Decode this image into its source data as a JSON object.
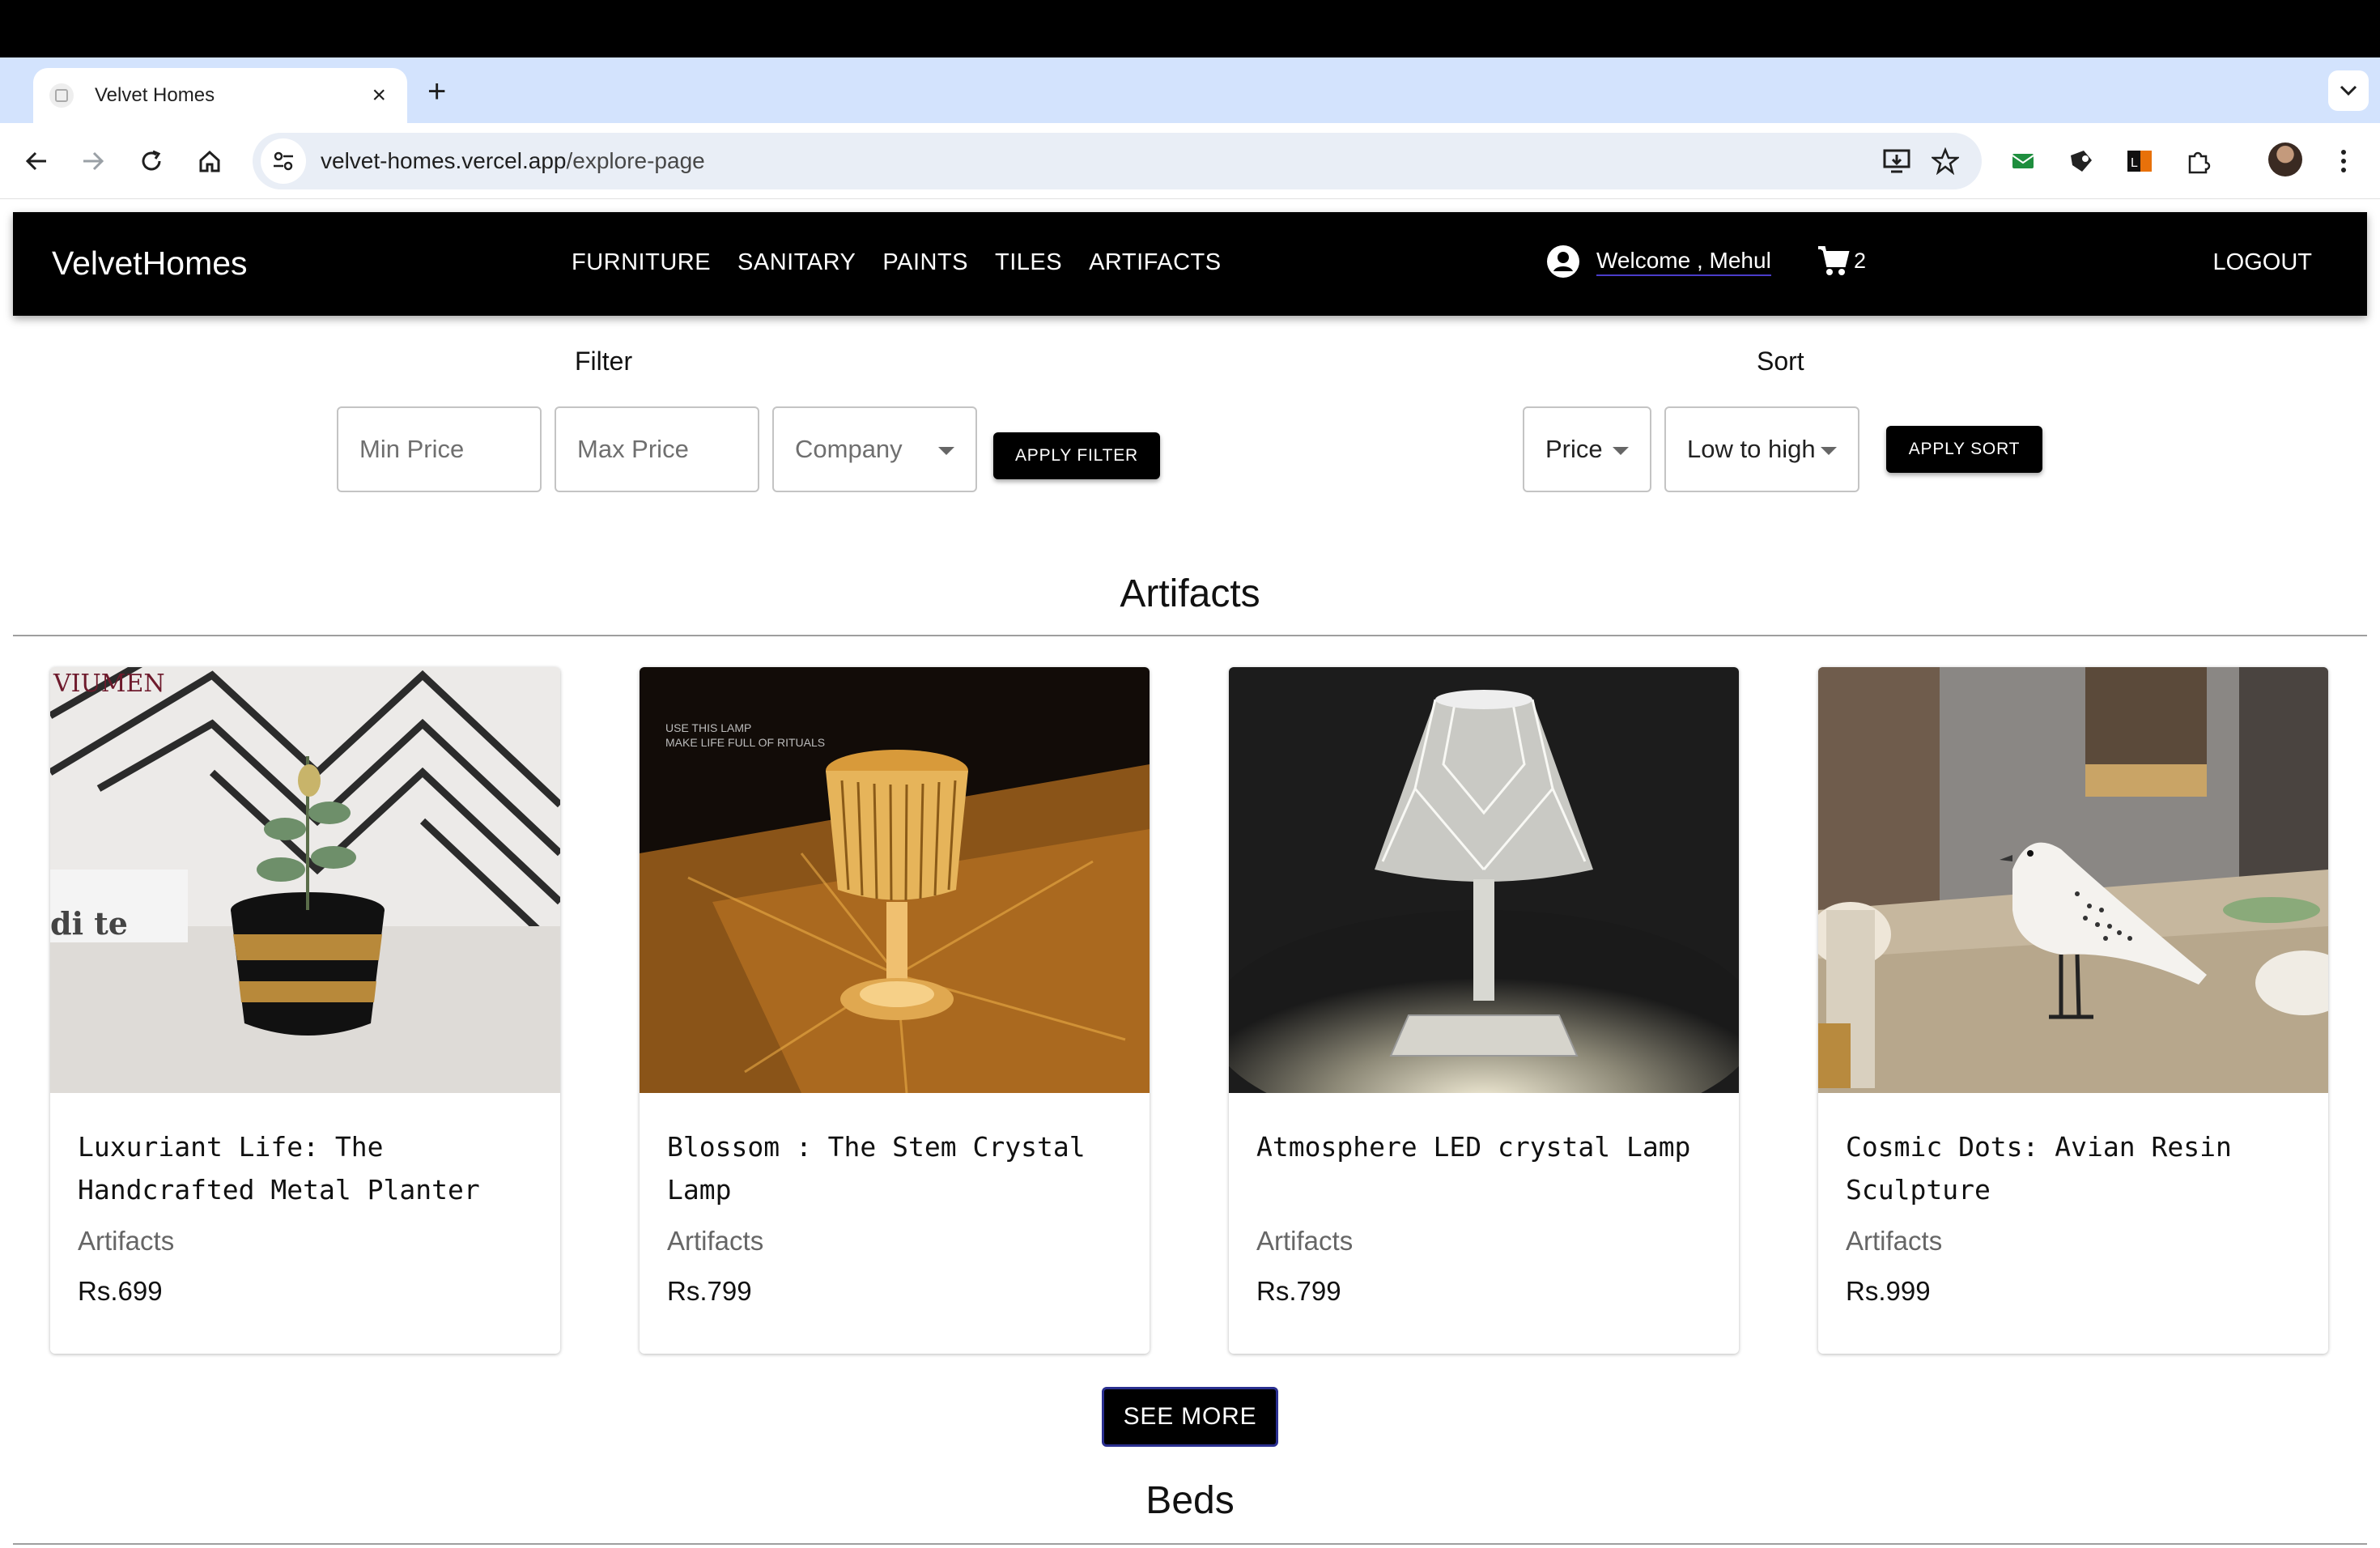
{
  "browser": {
    "tab_title": "Velvet Homes",
    "url_host": "velvet-homes.vercel.app",
    "url_path": "/explore-page"
  },
  "header": {
    "brand": "VelvetHomes",
    "nav": [
      "FURNITURE",
      "SANITARY",
      "PAINTS",
      "TILES",
      "ARTIFACTS"
    ],
    "welcome": "Welcome , Mehul",
    "cart_count": "2",
    "logout": "LOGOUT"
  },
  "filter": {
    "title": "Filter",
    "min_price_placeholder": "Min Price",
    "max_price_placeholder": "Max Price",
    "company_label": "Company",
    "apply_label": "APPLY FILTER"
  },
  "sort": {
    "title": "Sort",
    "field_value": "Price",
    "order_value": "Low to high",
    "apply_label": "APPLY SORT"
  },
  "sections": [
    {
      "title": "Artifacts",
      "products": [
        {
          "name": "Luxuriant Life: The Handcrafted Metal Planter",
          "category": "Artifacts",
          "price": "Rs.699",
          "image_overlay": "VIUMEN"
        },
        {
          "name": "Blossom : The Stem Crystal Lamp",
          "category": "Artifacts",
          "price": "Rs.799",
          "image_overlay": "USE THIS LAMP\nMAKE LIFE FULL OF RITUALS"
        },
        {
          "name": "Atmosphere LED crystal Lamp",
          "category": "Artifacts",
          "price": "Rs.799"
        },
        {
          "name": "Cosmic Dots: Avian Resin Sculpture",
          "category": "Artifacts",
          "price": "Rs.999"
        }
      ],
      "see_more": "SEE MORE"
    },
    {
      "title": "Beds"
    }
  ]
}
